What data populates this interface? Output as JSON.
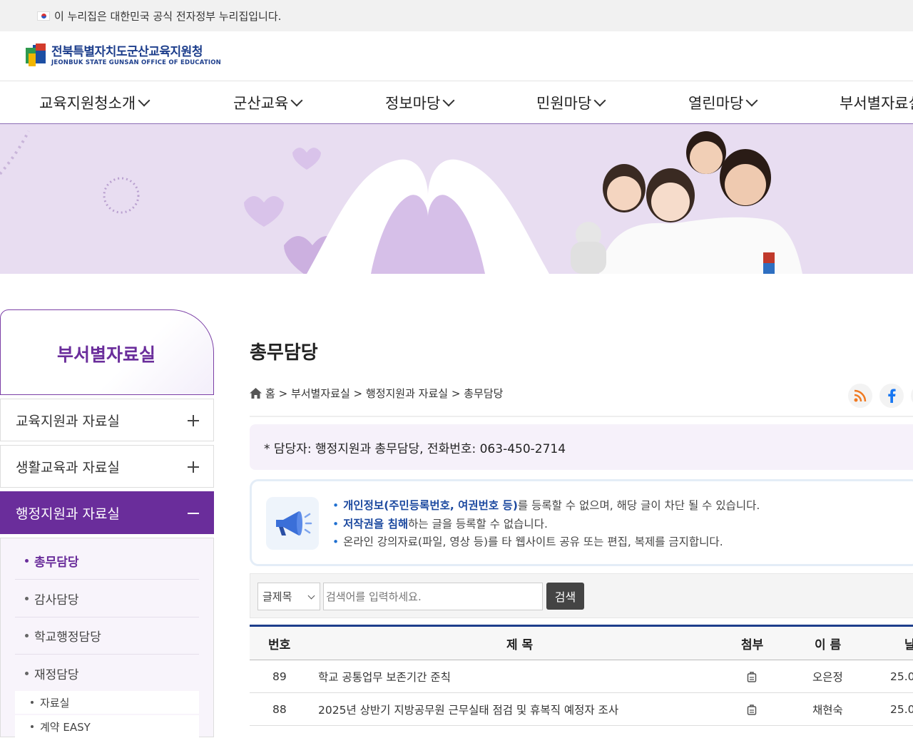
{
  "gov_banner": {
    "text": "이 누리집은 대한민국 공식 전자정부 누리집입니다."
  },
  "logo": {
    "name_ko": "전북특별자치도군산교육지원청",
    "name_en": "JEONBUK STATE GUNSAN OFFICE OF EDUCATION"
  },
  "gnb": [
    {
      "label": "교육지원청소개"
    },
    {
      "label": "군산교육"
    },
    {
      "label": "정보마당"
    },
    {
      "label": "민원마당"
    },
    {
      "label": "열린마당"
    },
    {
      "label": "부서별자료실"
    }
  ],
  "lnb": {
    "title": "부서별자료실",
    "items": [
      {
        "label": "교육지원과 자료실"
      },
      {
        "label": "생활교육과 자료실"
      },
      {
        "label": "행정지원과 자료실"
      }
    ],
    "sub_items": [
      {
        "label": "총무담당"
      },
      {
        "label": "감사담당"
      },
      {
        "label": "학교행정담당"
      },
      {
        "label": "재정담당"
      }
    ],
    "sub_sub_items": [
      {
        "label": "자료실"
      },
      {
        "label": "계약 EASY"
      }
    ]
  },
  "page": {
    "title": "총무담당",
    "breadcrumb": {
      "home": "홈",
      "sep": ">",
      "level1": "부서별자료실",
      "level2": "행정지원과 자료실",
      "level3": "총무담당"
    },
    "contact": "* 담당자: 행정지원과 총무담당, 전화번호: 063-450-2714",
    "notice": {
      "line1_bold": "개인정보(주민등록번호, 여권번호 등)",
      "line1_rest": "를 등록할 수 없으며, 해당 글이 차단 될 수 있습니다.",
      "line2_bold": "저작권을 침해",
      "line2_rest": "하는 글을 등록할 수 없습니다.",
      "line3": "온라인 강의자료(파일, 영상 등)를 타 웹사이트 공유 또는 편집, 복제를 금지합니다."
    }
  },
  "search": {
    "select_value": "글제목",
    "placeholder": "검색어를 입력하세요.",
    "button": "검색"
  },
  "table": {
    "headers": {
      "no": "번호",
      "title": "제 목",
      "attach": "첨부",
      "name": "이 름",
      "date": "날짜"
    },
    "rows": [
      {
        "no": "89",
        "title": "학교 공통업무 보존기간 준칙",
        "name": "오은정",
        "date": "25.0"
      },
      {
        "no": "88",
        "title": "2025년 상반기 지방공무원 근무실태 점검 및 휴복직 예정자 조사",
        "name": "채현숙",
        "date": "25.0"
      }
    ]
  },
  "icons": {
    "home": "home-icon",
    "rss": "rss-icon",
    "facebook": "facebook-icon",
    "attach": "attachment-icon",
    "megaphone": "megaphone-icon"
  },
  "colors": {
    "primary_purple": "#6a2d9b",
    "navy": "#1d3e8c",
    "banner_bg": "#e8ddf1"
  }
}
